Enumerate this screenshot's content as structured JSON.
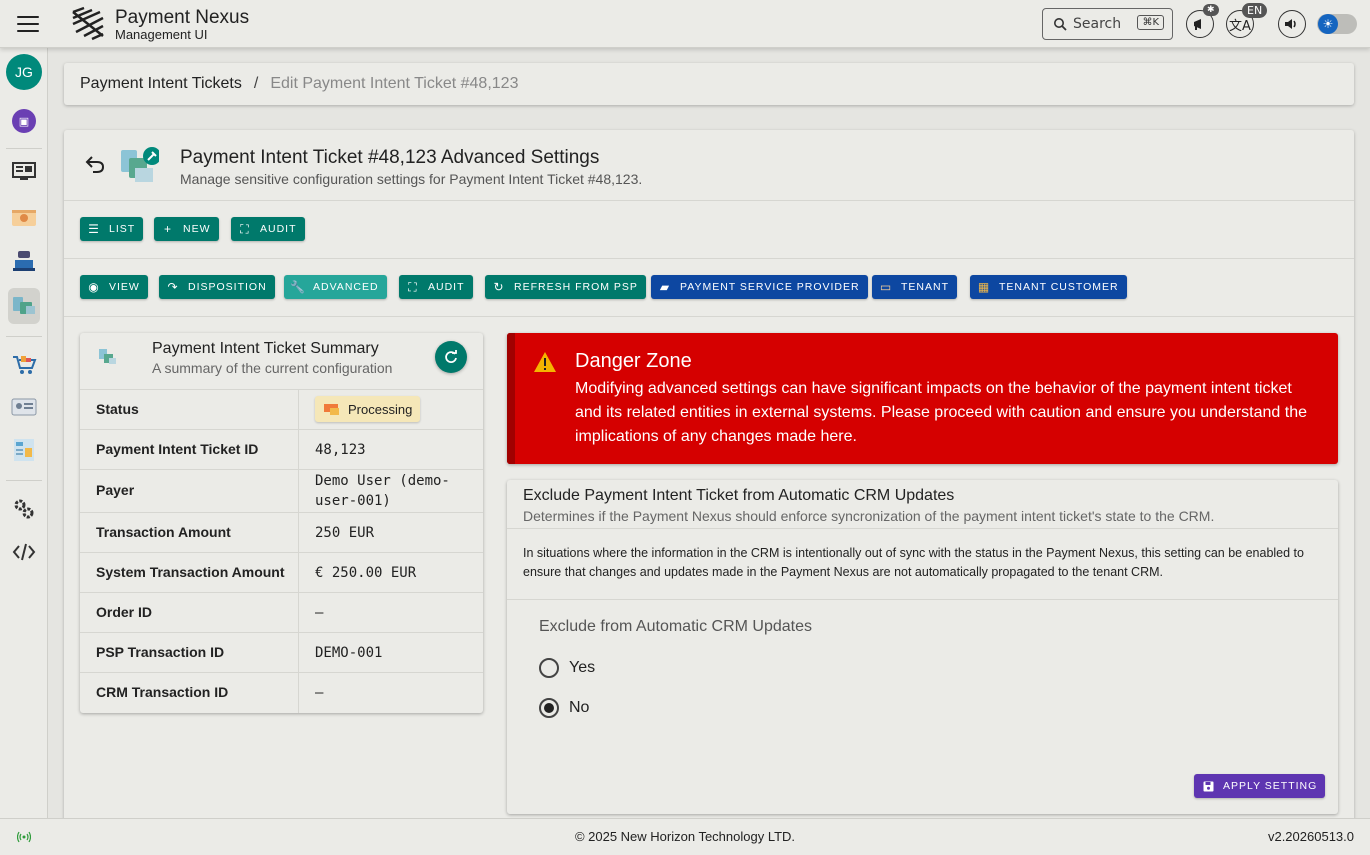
{
  "app": {
    "title": "Payment Nexus",
    "subtitle": "Management UI",
    "search_label": "Search",
    "search_shortcut": "⌘K",
    "language": "EN",
    "user_initials": "JG"
  },
  "sidebar": {
    "items": [
      {
        "name": "dashboard",
        "icon": "monitor-icon"
      },
      {
        "name": "tenants",
        "icon": "tenant-icon"
      },
      {
        "name": "psp",
        "icon": "psp-icon"
      },
      {
        "name": "payment-intents",
        "icon": "payment-intent-icon",
        "active": true
      },
      {
        "name": "shop",
        "icon": "cart-icon"
      },
      {
        "name": "customers",
        "icon": "id-card-icon"
      },
      {
        "name": "reports",
        "icon": "receipt-icon"
      },
      {
        "name": "settings",
        "icon": "gear-icon"
      },
      {
        "name": "developer",
        "icon": "code-icon"
      }
    ]
  },
  "breadcrumb": {
    "parent": "Payment Intent Tickets",
    "separator": "/",
    "current": "Edit Payment Intent Ticket #48,123"
  },
  "header": {
    "title": "Payment Intent Ticket #48,123 Advanced Settings",
    "subtitle": "Manage sensitive configuration settings for Payment Intent Ticket #48,123."
  },
  "toolbar1": {
    "list": "LIST",
    "new": "NEW",
    "audit": "AUDIT"
  },
  "toolbar2": {
    "view": "VIEW",
    "disposition": "DISPOSITION",
    "advanced": "ADVANCED",
    "audit": "AUDIT",
    "refresh": "REFRESH FROM PSP",
    "psp": "PAYMENT SERVICE PROVIDER",
    "tenant": "TENANT",
    "tenant_customer": "TENANT CUSTOMER"
  },
  "summary": {
    "title": "Payment Intent Ticket Summary",
    "subtitle": "A summary of the current configuration",
    "rows": [
      {
        "label": "Status",
        "value": "Processing"
      },
      {
        "label": "Payment Intent Ticket ID",
        "value": "48,123"
      },
      {
        "label": "Payer",
        "value": "Demo User (demo-user-001)"
      },
      {
        "label": "Transaction Amount",
        "value": "250 EUR"
      },
      {
        "label": "System Transaction Amount",
        "value": "€ 250.00 EUR"
      },
      {
        "label": "Order ID",
        "value": "–"
      },
      {
        "label": "PSP Transaction ID",
        "value": "DEMO-001"
      },
      {
        "label": "CRM Transaction ID",
        "value": "–"
      }
    ]
  },
  "danger": {
    "title": "Danger Zone",
    "text": "Modifying advanced settings can have significant impacts on the behavior of the payment intent ticket and its related entities in external systems. Please proceed with caution and ensure you understand the implications of any changes made here."
  },
  "setting": {
    "title": "Exclude Payment Intent Ticket from Automatic CRM Updates",
    "subtitle": "Determines if the Payment Nexus should enforce syncronization of the payment intent ticket's state to the CRM.",
    "description": "In situations where the information in the CRM is intentionally out of sync with the status in the Payment Nexus, this setting can be enabled to ensure that changes and updates made in the Payment Nexus are not automatically propagated to the tenant CRM.",
    "field_label": "Exclude from Automatic CRM Updates",
    "options": [
      "Yes",
      "No"
    ],
    "selected": "No",
    "apply_label": "APPLY SETTING"
  },
  "footer": {
    "copyright": "© 2025 New Horizon Technology LTD.",
    "version": "v2.20260513.0"
  },
  "colors": {
    "teal": "#00796b",
    "blue": "#0d47a1",
    "danger": "#d50000",
    "purple": "#5e35b1"
  }
}
